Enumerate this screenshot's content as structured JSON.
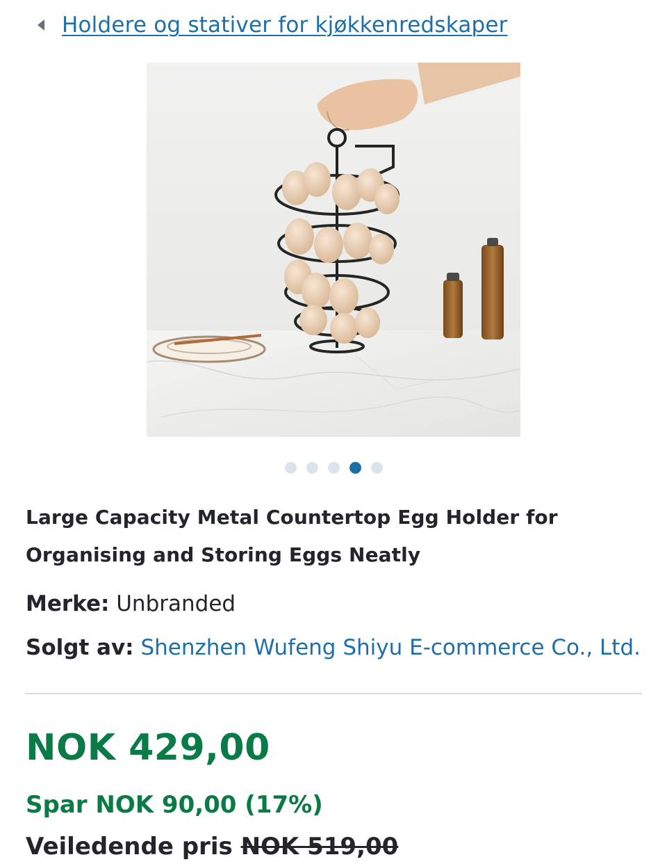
{
  "breadcrumb": {
    "label": "Holdere og stativer for kjøkkenredskaper"
  },
  "gallery": {
    "image_alt": "Large Capacity Metal Countertop Egg Holder",
    "dots_total": 5,
    "active_index": 3
  },
  "product": {
    "title": "Large Capacity Metal Countertop Egg Holder for Organising and Storing Eggs Neatly",
    "brand_key": "Merke:",
    "brand_value": "Unbranded",
    "seller_key": "Solgt av:",
    "seller_value": "Shenzhen Wufeng Shiyu E-commerce Co., Ltd."
  },
  "pricing": {
    "price": "NOK 429,00",
    "savings": "Spar NOK 90,00 (17%)",
    "rrp_label": "Veiledende pris",
    "rrp_value": "NOK 519,00"
  },
  "colors": {
    "link": "#1e6fa8",
    "price_green": "#0a7a46",
    "dot_inactive": "#dbe3ec",
    "dot_active": "#1e6fa8"
  }
}
